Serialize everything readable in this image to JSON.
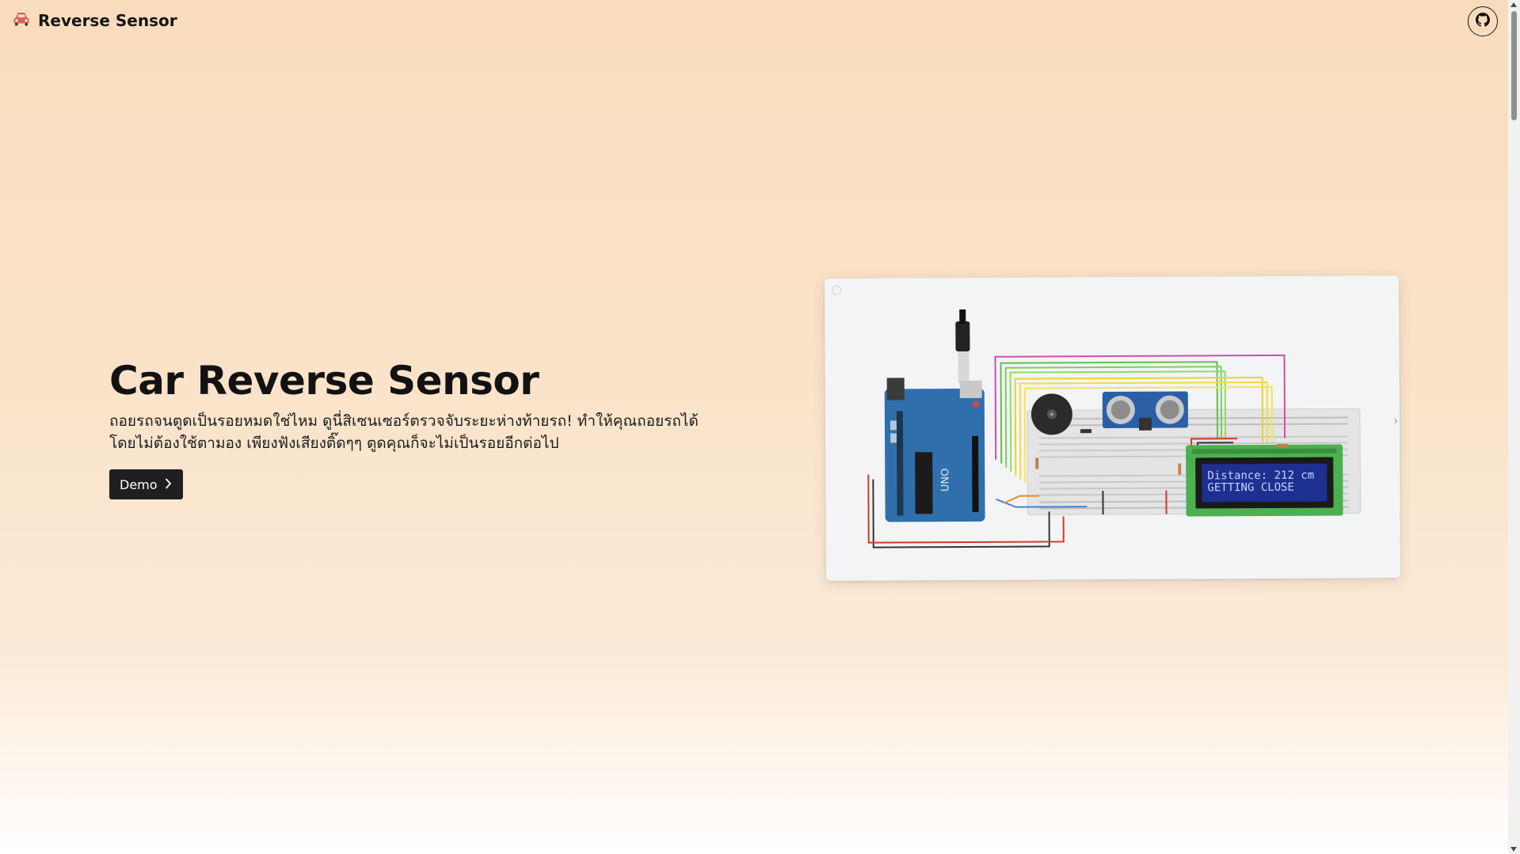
{
  "navbar": {
    "brand_icon": "car-icon",
    "brand_name": "Reverse Sensor",
    "github_icon": "github-icon"
  },
  "hero": {
    "title": "Car Reverse Sensor",
    "description_line1": "ถอยรถจนตูดเป็นรอยหมดใช่ไหม ดูนี่สิเซนเซอร์ตรวจจับระยะห่างท้ายรถ! ทำให้คุณถอยรถได้",
    "description_line2": "โดยไม่ต้องใช้ตามอง เพียงฟังเสียงติ๊ดๆๆ ตูดคุณก็จะไม่เป็นรอยอีกต่อไป",
    "demo_label": "Demo",
    "demo_icon": "chevron-right-icon"
  },
  "circuit": {
    "lcd_line1": "Distance: 212 cm",
    "lcd_line2": "GETTING CLOSE",
    "board_label": "UNO"
  },
  "colors": {
    "background_top": "#f9dcbd",
    "button_bg": "#1f1f1f",
    "arduino_blue": "#2f6fab",
    "lcd_screen": "#1d2f8f",
    "lcd_frame": "#4caf50"
  }
}
